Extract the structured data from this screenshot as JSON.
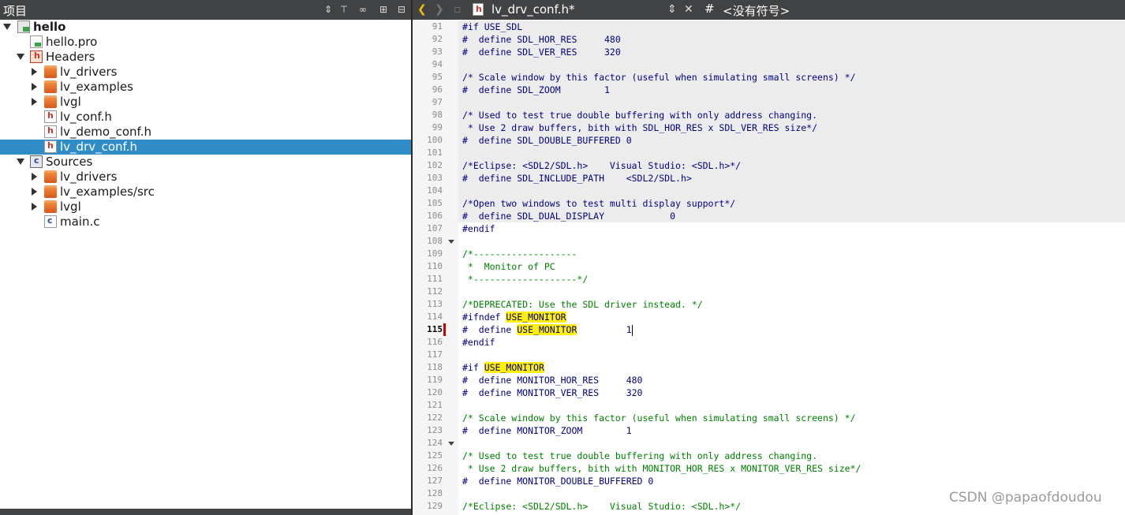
{
  "projects_panel": {
    "title": "项目",
    "tree": [
      {
        "label": "hello",
        "indent": 0,
        "expanded": true,
        "icon": "project-icon",
        "bold": true
      },
      {
        "label": "hello.pro",
        "indent": 1,
        "icon": "pro-file-icon"
      },
      {
        "label": "Headers",
        "indent": 1,
        "expanded": true,
        "icon": "headers-folder-icon"
      },
      {
        "label": "lv_drivers",
        "indent": 2,
        "expanded": false,
        "icon": "folder-icon"
      },
      {
        "label": "lv_examples",
        "indent": 2,
        "expanded": false,
        "icon": "folder-icon"
      },
      {
        "label": "lvgl",
        "indent": 2,
        "expanded": false,
        "icon": "folder-icon"
      },
      {
        "label": "lv_conf.h",
        "indent": 2,
        "icon": "header-file-icon"
      },
      {
        "label": "lv_demo_conf.h",
        "indent": 2,
        "icon": "header-file-icon"
      },
      {
        "label": "lv_drv_conf.h",
        "indent": 2,
        "icon": "header-file-icon",
        "selected": true
      },
      {
        "label": "Sources",
        "indent": 1,
        "expanded": true,
        "icon": "sources-folder-icon"
      },
      {
        "label": "lv_drivers",
        "indent": 2,
        "expanded": false,
        "icon": "folder-icon"
      },
      {
        "label": "lv_examples/src",
        "indent": 2,
        "expanded": false,
        "icon": "folder-icon"
      },
      {
        "label": "lvgl",
        "indent": 2,
        "expanded": false,
        "icon": "folder-icon"
      },
      {
        "label": "main.c",
        "indent": 2,
        "icon": "c-file-icon"
      }
    ]
  },
  "editor": {
    "file_name": "lv_drv_conf.h*",
    "symbol": "<没有符号>",
    "hash": "#",
    "current_line": 115,
    "lines": [
      {
        "n": 91,
        "t": "#if USE_SDL",
        "k": "pp",
        "shade": true
      },
      {
        "n": 92,
        "t": "#  define SDL_HOR_RES     480",
        "k": "pp",
        "shade": true
      },
      {
        "n": 93,
        "t": "#  define SDL_VER_RES     320",
        "k": "pp",
        "shade": true
      },
      {
        "n": 94,
        "t": "",
        "k": "pp",
        "shade": true
      },
      {
        "n": 95,
        "t": "/* Scale window by this factor (useful when simulating small screens) */",
        "k": "pp",
        "shade": true
      },
      {
        "n": 96,
        "t": "#  define SDL_ZOOM        1",
        "k": "pp",
        "shade": true
      },
      {
        "n": 97,
        "t": "",
        "k": "pp",
        "shade": true
      },
      {
        "n": 98,
        "t": "/* Used to test true double buffering with only address changing.",
        "k": "pp",
        "shade": true
      },
      {
        "n": 99,
        "t": " * Use 2 draw buffers, bith with SDL_HOR_RES x SDL_VER_RES size*/",
        "k": "pp",
        "shade": true
      },
      {
        "n": 100,
        "t": "#  define SDL_DOUBLE_BUFFERED 0",
        "k": "pp",
        "shade": true
      },
      {
        "n": 101,
        "t": "",
        "k": "pp",
        "shade": true
      },
      {
        "n": 102,
        "t": "/*Eclipse: <SDL2/SDL.h>    Visual Studio: <SDL.h>*/",
        "k": "pp",
        "shade": true
      },
      {
        "n": 103,
        "t": "#  define SDL_INCLUDE_PATH    <SDL2/SDL.h>",
        "k": "pp",
        "shade": true
      },
      {
        "n": 104,
        "t": "",
        "k": "pp",
        "shade": true
      },
      {
        "n": 105,
        "t": "/*Open two windows to test multi display support*/",
        "k": "pp",
        "shade": true
      },
      {
        "n": 106,
        "t": "#  define SDL_DUAL_DISPLAY            0",
        "k": "pp",
        "shade": true
      },
      {
        "n": 107,
        "t": "#endif",
        "k": "pp"
      },
      {
        "n": 108,
        "t": "",
        "k": "pp",
        "fold": true
      },
      {
        "n": 109,
        "t": "/*-------------------",
        "k": "cm"
      },
      {
        "n": 110,
        "t": " *  Monitor of PC",
        "k": "cm"
      },
      {
        "n": 111,
        "t": " *-------------------*/",
        "k": "cm"
      },
      {
        "n": 112,
        "t": "",
        "k": "pp"
      },
      {
        "n": 113,
        "t": "/*DEPRECATED: Use the SDL driver instead. */",
        "k": "cm"
      },
      {
        "n": 114,
        "t": "#ifndef ",
        "k": "pp",
        "hl": "USE_MONITOR",
        "after": ""
      },
      {
        "n": 115,
        "t": "#  define ",
        "k": "pp",
        "hl": "USE_MONITOR",
        "after": "         1",
        "caret": true
      },
      {
        "n": 116,
        "t": "#endif",
        "k": "pp"
      },
      {
        "n": 117,
        "t": "",
        "k": "pp"
      },
      {
        "n": 118,
        "t": "#if ",
        "k": "pp",
        "hl": "USE_MONITOR",
        "after": ""
      },
      {
        "n": 119,
        "t": "#  define MONITOR_HOR_RES     480",
        "k": "pp"
      },
      {
        "n": 120,
        "t": "#  define MONITOR_VER_RES     320",
        "k": "pp"
      },
      {
        "n": 121,
        "t": "",
        "k": "pp"
      },
      {
        "n": 122,
        "t": "/* Scale window by this factor (useful when simulating small screens) */",
        "k": "cm"
      },
      {
        "n": 123,
        "t": "#  define MONITOR_ZOOM        1",
        "k": "pp"
      },
      {
        "n": 124,
        "t": "",
        "k": "pp",
        "fold": true
      },
      {
        "n": 125,
        "t": "/* Used to test true double buffering with only address changing.",
        "k": "cm"
      },
      {
        "n": 126,
        "t": " * Use 2 draw buffers, bith with MONITOR_HOR_RES x MONITOR_VER_RES size*/",
        "k": "cm"
      },
      {
        "n": 127,
        "t": "#  define MONITOR_DOUBLE_BUFFERED 0",
        "k": "pp"
      },
      {
        "n": 128,
        "t": "",
        "k": "pp"
      },
      {
        "n": 129,
        "t": "/*Eclipse: <SDL2/SDL.h>    Visual Studio: <SDL.h>*/",
        "k": "cm"
      }
    ]
  },
  "watermark": "CSDN @papaofdoudou"
}
